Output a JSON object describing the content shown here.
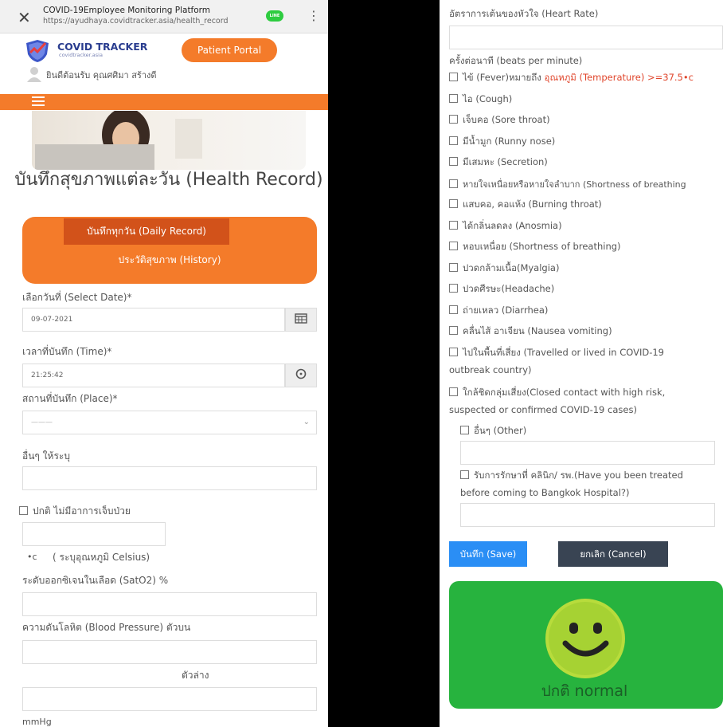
{
  "browser": {
    "title": "COVID-19Employee Monitoring Platform",
    "url": "https://ayudhaya.covidtracker.asia/health_record",
    "line_badge": "LINE"
  },
  "header": {
    "logo_name": "COVID TRACKER",
    "logo_sub": "covidtracker.asia",
    "portal_button": "Patient Portal",
    "welcome": "ยินดีต้อนรับ คุณศศิมา สร้างดี"
  },
  "page_title": "บันทึกสุขภาพแต่ละวัน (Health Record)",
  "tabs": {
    "daily": "บันทึกทุกวัน (Daily Record)",
    "history": "ประวัติสุขภาพ (History)"
  },
  "form": {
    "date_label": "เลือกวันที่ (Select Date)*",
    "date_value": "09-07-2021",
    "time_label": "เวลาที่บันทึก (Time)*",
    "time_value": "21:25:42",
    "place_label": "สถานที่บันทึก (Place)*",
    "place_value": "———",
    "other_label": "อื่นๆ ให้ระบุ",
    "normal_check": "ปกติ ไม่มีอาการเจ็บป่วย",
    "temp_unit": "•c",
    "temp_hint": "( ระบุอุณหภูมิ Celsius)",
    "spo2_label": "ระดับออกซิเจนในเลือด (SatO2) %",
    "bp_label": "ความดันโลหิต (Blood Pressure) ตัวบน",
    "bp_lower_label": "ตัวล่าง",
    "bp_unit": "mmHg",
    "heart_rate_label": "อัตราการเต้นของหัวใจ (Heart Rate)",
    "heart_rate_unit": "ครั้งต่อนาที (beats per minute)",
    "fever_label": "ไข้ (Fever)หมายถึง",
    "fever_temp": "อุณหภูมิ (Temperature) >=37.5•c",
    "symptoms": [
      "ไอ (Cough)",
      "เจ็บคอ (Sore throat)",
      "มีน้ำมูก (Runny nose)",
      "มีเสมหะ (Secretion)",
      "หายใจเหนื่อยหรือหายใจลำบาก (Shortness of breathing",
      "แสบคอ, คอแห้ง (Burning throat)",
      "ได้กลิ่นลดลง (Anosmia)",
      "หอบเหนื่อย (Shortness of breathing)",
      "ปวดกล้ามเนื้อ(Myalgia)",
      "ปวดศีรษะ(Headache)",
      "ถ่ายเหลว (Diarrhea)",
      "คลื่นไส้ อาเจียน (Nausea vomiting)"
    ],
    "travel_line1": "ไปในพื้นที่เสี่ยง (Travelled or lived in COVID-19",
    "travel_line2": "outbreak country)",
    "contact_line1": "ใกล้ชิดกลุ่มเสี่ยง(Closed contact with high risk,",
    "contact_line2": "suspected or confirmed COVID-19 cases)",
    "other_symptom": "อื่นๆ (Other)",
    "treated_line1": "รับการรักษาที่ คลินิก/ รพ.(Have you been treated",
    "treated_line2": "before coming to Bangkok Hospital?)",
    "save_button": "บันทึก (Save)",
    "cancel_button": "ยกเลิก (Cancel)"
  },
  "status": {
    "text": "ปกติ normal",
    "color": "#27b33e"
  },
  "colors": {
    "brand_orange": "#f47b2a",
    "tab_active": "#d2521a",
    "save_blue": "#2a8ef5",
    "cancel_dark": "#394453"
  }
}
